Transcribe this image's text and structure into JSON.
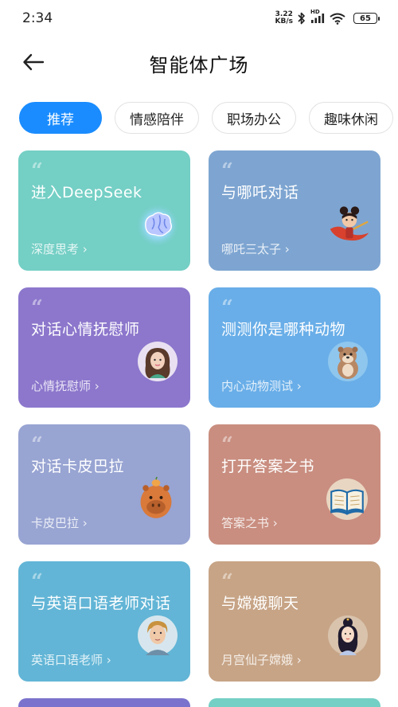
{
  "status": {
    "time": "2:34",
    "net_speed_value": "3.22",
    "net_speed_unit": "KB/s",
    "hd_label": "HD",
    "battery": "65"
  },
  "header": {
    "title": "智能体广场"
  },
  "tabs": [
    {
      "label": "推荐",
      "active": true
    },
    {
      "label": "情感陪伴",
      "active": false
    },
    {
      "label": "职场办公",
      "active": false
    },
    {
      "label": "趣味休闲",
      "active": false
    }
  ],
  "cards": [
    {
      "title": "进入DeepSeek",
      "subtitle": "深度思考 ›",
      "color": "#74cfc5",
      "icon": "brain-icon"
    },
    {
      "title": "与哪吒对话",
      "subtitle": "哪吒三太子 ›",
      "color": "#7ea5d1",
      "icon": "nezha-avatar"
    },
    {
      "title": "对话心情抚慰师",
      "subtitle": "心情抚慰师 ›",
      "color": "#8c77cc",
      "icon": "counselor-avatar"
    },
    {
      "title": "测测你是哪种动物",
      "subtitle": "内心动物测试 ›",
      "color": "#69aee8",
      "icon": "otter-avatar"
    },
    {
      "title": "对话卡皮巴拉",
      "subtitle": "卡皮巴拉 ›",
      "color": "#98a4d2",
      "icon": "capybara-avatar"
    },
    {
      "title": "打开答案之书",
      "subtitle": "答案之书 ›",
      "color": "#c98e80",
      "icon": "book-icon"
    },
    {
      "title": "与英语口语老师对话",
      "subtitle": "英语口语老师 ›",
      "color": "#62b5d6",
      "icon": "teacher-avatar"
    },
    {
      "title": "与嫦娥聊天",
      "subtitle": "月宫仙子嫦娥 ›",
      "color": "#c7a486",
      "icon": "change-avatar"
    }
  ],
  "partial_cards": [
    {
      "color": "#7a72cc"
    },
    {
      "color": "#74cfc5"
    }
  ]
}
